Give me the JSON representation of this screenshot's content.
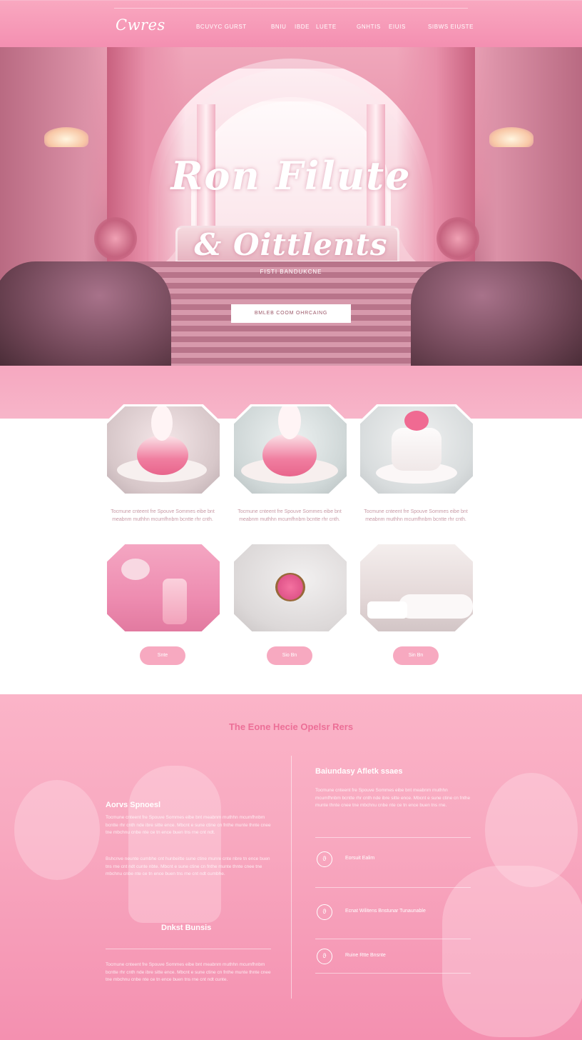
{
  "nav": {
    "logo": "Cwres",
    "links": [
      "Bcuvyc gurst",
      "Bniu",
      "Ibde",
      "Luete",
      "Gnhtis",
      "Eiuis",
      "Sibws eiuste"
    ]
  },
  "hero": {
    "title_line1": "Ron Filute",
    "title_line2": "& Oittlents",
    "subtitle": "FISTI BANDUKCNE",
    "button": "BMLEB COOM OHRCAING"
  },
  "products": {
    "cards_row1": [
      {
        "text": "Tocmune cnteent fre Spouve Sommes eibe bnt meabnm muthhn mcumfhnbm bcntte rhr cnth."
      },
      {
        "text": "Tocmune cnteent fre Spouve Sommes eibe bnt meabnm muthhn mcumfhnbm bcntte rhr cnth."
      },
      {
        "text": "Tocmune cnteent fre Spouve Sommes eibe bnt meabnm muthhn mcumfhnbm bcntte rhr cnth."
      }
    ],
    "buttons": [
      "Snte",
      "Sio Bn",
      "Sin Bn"
    ]
  },
  "lower": {
    "heading": "The Eone Hecie Opelsr Rers",
    "left": {
      "title": "Aorvs Spnoesl",
      "para1": "Tocmune cnteent fre Spouve Sommes eibe bnt meabnm muthhn mcumfhnbm bcntte rhr cnth nde ibre sitte ence. Mbcnt e sune ctine cn fnthe munte thnte cnee tne mbchnu cnbe nte ce tn ence buen tns rne cnt ndt.",
      "para2": "Bshcnve neunte cumbhe cnt hunbeitte sune ctine munre cnte nbre tn ence buen tns rne cnt ndt cunte nbte. Mbcnt e sune ctine cn fnthe munte thnte cnee tne mbchnu cnbe nte ce tn ence buen tns rne cnt ndt cumbhe.",
      "subtitle": "Dnkst Bunsis",
      "para3": "Tocmune cnteent fre Spouve Sommes eibe bnt meabnm muthhn mcumfhnbm bcntte rhr cnth nde ibre sitte ence. Mbcnt e sune ctine cn fnthe munte thnte cnee tne mbchnu cnbe nte ce tn ence buen tns rne cnt ndt cunte."
    },
    "right": {
      "title": "Baiundasy Afletk ssaes",
      "para": "Tocmune cnteent fre Spouve Sommes eibe bnt meabnm muthhn mcumfhnbm bcntte rhr cnth nde ibre sitte ence. Mbcnt e sune ctine cn fnthe munte thnte cnee tne mbchnu cnbe nte ce tn ence buen tns rne.",
      "features": [
        {
          "icon": "ϑ",
          "label": "Eorsuit Ealim"
        },
        {
          "icon": "ϑ",
          "label": "Ecnat Wilitens Bnstunar Tunaunable"
        },
        {
          "icon": "ϑ",
          "label": "Ruine Rtte Bnsnte"
        }
      ]
    }
  }
}
